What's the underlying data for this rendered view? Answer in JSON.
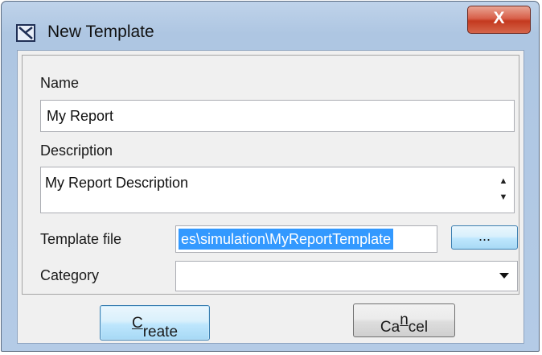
{
  "window": {
    "title": "New Template",
    "close_label": "X"
  },
  "form": {
    "name_label": "Name",
    "name_value": "My Report",
    "description_label": "Description",
    "description_value": "My Report Description",
    "template_file_label": "Template file",
    "template_file_value": "es\\simulation\\MyReportTemplate",
    "browse_label": "...",
    "category_label": "Category",
    "category_value": ""
  },
  "buttons": {
    "create_pre": "",
    "create_mnemonic": "C",
    "create_post": "reate",
    "cancel_pre": "Ca",
    "cancel_mnemonic": "n",
    "cancel_post": "cel"
  },
  "colors": {
    "selection": "#3399ff",
    "close_button": "#c4391f",
    "frame": "#aec6e2"
  }
}
